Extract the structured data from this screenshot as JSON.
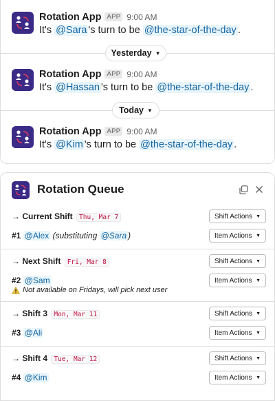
{
  "messages": [
    {
      "sender": "Rotation App",
      "badge": "APP",
      "time": "9:00 AM",
      "prefix": "It's ",
      "user": "@Sara",
      "middle": "'s turn to be ",
      "channel": "@the-star-of-the-day",
      "suffix": "."
    },
    {
      "sender": "Rotation App",
      "badge": "APP",
      "time": "9:00 AM",
      "prefix": "It's ",
      "user": "@Hassan",
      "middle": "'s turn to be ",
      "channel": "@the-star-of-the-day",
      "suffix": "."
    },
    {
      "sender": "Rotation App",
      "badge": "APP",
      "time": "9:00 AM",
      "prefix": "It's ",
      "user": "@Kim",
      "middle": "'s turn to be ",
      "channel": "@the-star-of-the-day",
      "suffix": "."
    }
  ],
  "dividers": [
    {
      "label": "Yesterday"
    },
    {
      "label": "Today"
    }
  ],
  "queue": {
    "title": "Rotation Queue",
    "shift_actions_label": "Shift Actions",
    "item_actions_label": "Item Actions",
    "shifts": [
      {
        "arrow": "→",
        "label": "Current Shift",
        "date": "Thu, Mar 7",
        "item_num": "#1",
        "item_user": "@Alex",
        "item_note_pre": " (substituting ",
        "item_note_user": "@Sara",
        "item_note_post": ")"
      },
      {
        "arrow": "→",
        "label": "Next Shift",
        "date": "Fri, Mar 8",
        "item_num": "#2",
        "item_user": "@Sam",
        "warning": "Not available on Fridays, will pick next user"
      },
      {
        "arrow": "→",
        "label": "Shift 3",
        "date": "Mon, Mar 11",
        "item_num": "#3",
        "item_user": "@Ali"
      },
      {
        "arrow": "→",
        "label": "Shift 4",
        "date": "Tue, Mar 12",
        "item_num": "#4",
        "item_user": "@Kim"
      }
    ]
  },
  "colors": {
    "brand": "#3b2a86",
    "mention": "#1264a3",
    "date_code": "#c01343"
  }
}
